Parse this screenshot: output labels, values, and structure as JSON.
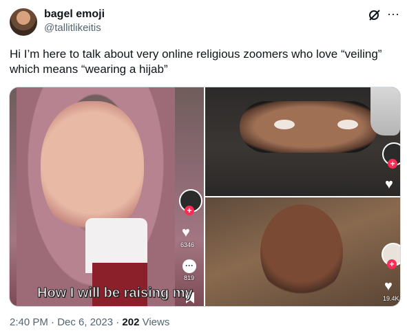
{
  "author": {
    "name": "bagel emoji",
    "handle": "@tallitlikeitis"
  },
  "icons": {
    "grok": "grok-icon",
    "more": "more-icon"
  },
  "tweet": {
    "text": "Hi I’m here to talk about very online religious zoomers who love “veiling” which means “wearing a hijab”"
  },
  "media": {
    "panel1": {
      "likes": "6346",
      "comments": "819",
      "caption": "How I will be raising my"
    },
    "panel3": {
      "likes": "19.4K"
    }
  },
  "meta": {
    "time": "2:40 PM · Dec 6, 2023 · ",
    "views_count": "202",
    "views_label": " Views"
  },
  "colors": {
    "accent_pink": "#fe2c55",
    "text": "#0f1419",
    "muted": "#536471"
  }
}
